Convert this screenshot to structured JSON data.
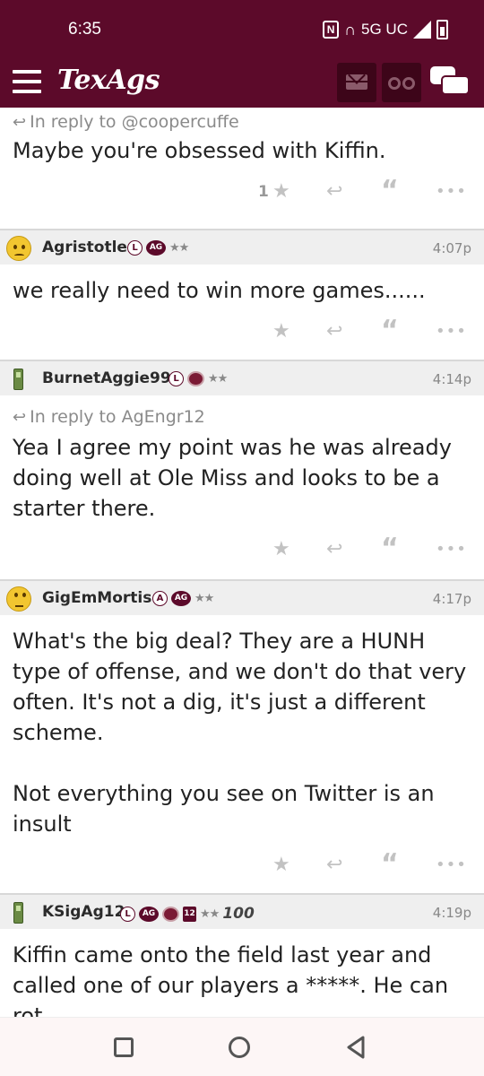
{
  "status_bar": {
    "time": "6:35",
    "network": "5G UC",
    "nfc_icon": "N",
    "icons": [
      "nfc-icon",
      "headphones-icon",
      "signal-icon",
      "battery-icon"
    ]
  },
  "header": {
    "logo": "TexAgs",
    "brand_color": "#5c0a2a",
    "icons": [
      "menu-icon",
      "mail-icon",
      "binoculars-icon",
      "chat-icon"
    ]
  },
  "posts": [
    {
      "username": "",
      "time": "",
      "reply_to": "In reply to @coopercuffe",
      "text": "Maybe you're obsessed with Kiffin.",
      "star_count": "1",
      "continued": true
    },
    {
      "username": "Agristotle",
      "avatar": "sad-emoji-icon",
      "badge_l": "L",
      "badge_ag": "AG",
      "stars": "★★",
      "time": "4:07p",
      "reply_to": "",
      "text": "we really need to win more games......",
      "star_count": ""
    },
    {
      "username": "BurnetAggie99",
      "avatar": "phone-icon",
      "badge_l": "L",
      "stars": "★★",
      "time": "4:14p",
      "reply_to": "In reply to AgEngr12",
      "text": "Yea I agree my point was he was already doing well at Ole Miss and looks to be a starter there.",
      "star_count": ""
    },
    {
      "username": "GigEmMortis",
      "avatar": "rolling-eyes-emoji-icon",
      "badge_l": "A",
      "badge_ag": "AG",
      "stars": "★★",
      "time": "4:17p",
      "reply_to": "",
      "text": "What's the big deal? They are a HUNH type of offense, and we don't do that very often. It's not a dig, it's just a different scheme.\n\nNot everything you see on Twitter is an insult",
      "star_count": ""
    },
    {
      "username": "KSigAg12",
      "avatar": "phone-icon",
      "badge_l": "L",
      "badge_ag": "AG",
      "badge_12": "12",
      "stars": "★★",
      "badge_100": "100",
      "time": "4:19p",
      "reply_to": "",
      "text": "Kiffin came onto the field last year and called one of our players a *****. He can rot.",
      "star_count": ""
    }
  ],
  "nav": {
    "icons": [
      "recents-icon",
      "home-icon",
      "back-icon"
    ]
  }
}
